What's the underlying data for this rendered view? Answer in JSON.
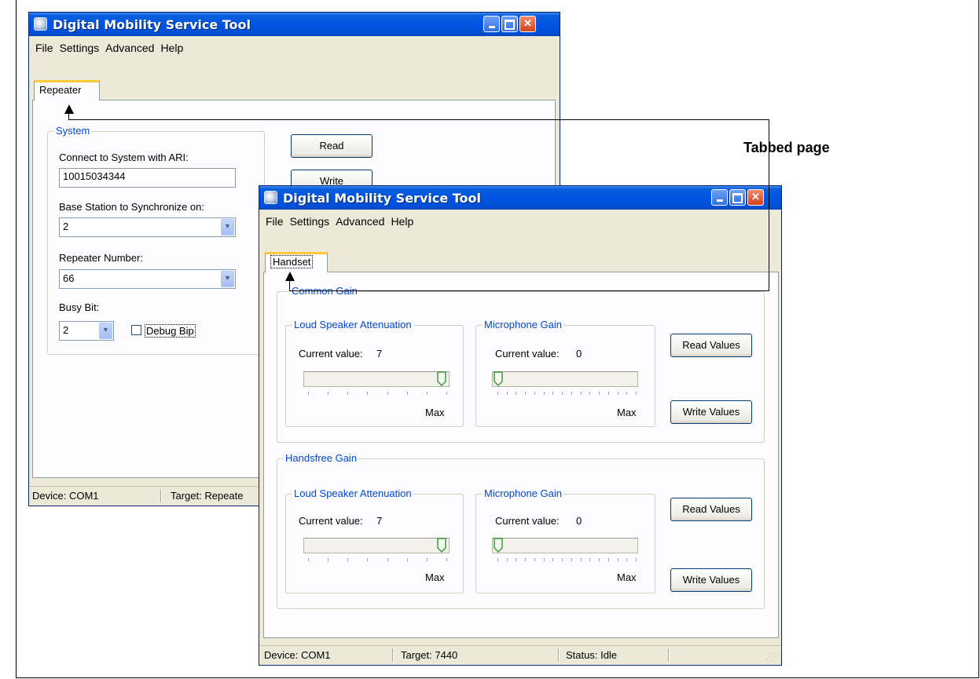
{
  "back_window": {
    "title": "Digital Mobility Service Tool",
    "menu": [
      "File",
      "Settings",
      "Advanced",
      "Help"
    ],
    "tab": "Repeater",
    "system_group": "System",
    "ari_label": "Connect to System with ARI:",
    "ari_value": "10015034344",
    "base_station_label": "Base Station to Synchronize on:",
    "base_station_value": "2",
    "repeater_number_label": "Repeater Number:",
    "repeater_number_value": "66",
    "busy_bit_label": "Busy Bit:",
    "busy_bit_value": "2",
    "debug_bip_label": "Debug Bip",
    "read_button": "Read",
    "write_button": "Write",
    "status_device": "Device: COM1",
    "status_target": "Target: Repeate"
  },
  "front_window": {
    "title": "Digital Mobility Service Tool",
    "menu": [
      "File",
      "Settings",
      "Advanced",
      "Help"
    ],
    "tab": "Handset",
    "common_gain": {
      "title": "Common Gain",
      "speaker": {
        "title": "Loud Speaker Attenuation",
        "current_label": "Current value:",
        "value": "7",
        "max_label": "Max",
        "level": 1.0
      },
      "microphone": {
        "title": "Microphone Gain",
        "current_label": "Current value:",
        "value": "0",
        "max_label": "Max",
        "level": 0.0
      },
      "read_button": "Read Values",
      "write_button": "Write Values"
    },
    "handsfree_gain": {
      "title": "Handsfree Gain",
      "speaker": {
        "title": "Loud Speaker Attenuation",
        "current_label": "Current value:",
        "value": "7",
        "max_label": "Max",
        "level": 1.0
      },
      "microphone": {
        "title": "Microphone Gain",
        "current_label": "Current value:",
        "value": "0",
        "max_label": "Max",
        "level": 0.0
      },
      "read_button": "Read Values",
      "write_button": "Write Values"
    },
    "status_device": "Device: COM1",
    "status_target": "Target: 7440",
    "status_state": "Status: Idle"
  },
  "callout": {
    "label": "Tabbed page"
  },
  "colors": {
    "titlebar": "#0054e3",
    "group_title": "#0046d5",
    "tab_highlight": "#ffc83c"
  }
}
